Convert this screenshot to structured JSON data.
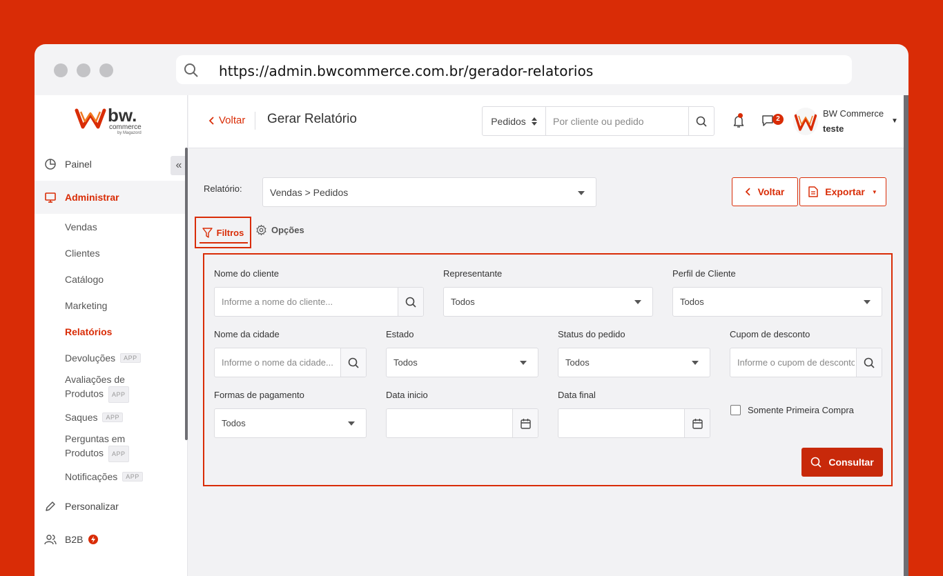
{
  "browser": {
    "url": "https://admin.bwcommerce.com.br/gerador-relatorios"
  },
  "brand": {
    "logo_text": "bw.",
    "logo_sub": "commerce",
    "logo_by": "by Magazord",
    "accent": "#d92c06"
  },
  "sidebar": {
    "collapse_glyph": "«",
    "items": [
      {
        "label": "Painel",
        "icon": "pie-chart-icon"
      },
      {
        "label": "Administrar",
        "icon": "monitor-icon",
        "active": true
      },
      {
        "label": "Personalizar",
        "icon": "pencil-icon"
      },
      {
        "label": "B2B",
        "icon": "users-icon"
      }
    ],
    "sub_items": [
      {
        "label": "Vendas"
      },
      {
        "label": "Clientes"
      },
      {
        "label": "Catálogo"
      },
      {
        "label": "Marketing"
      },
      {
        "label": "Relatórios",
        "active": true
      },
      {
        "label": "Devoluções",
        "tag": "APP"
      },
      {
        "label_1": "Avaliações de",
        "label_2": "Produtos",
        "tag": "APP"
      },
      {
        "label": "Saques",
        "tag": "APP"
      },
      {
        "label_1": "Perguntas em",
        "label_2": "Produtos",
        "tag": "APP"
      },
      {
        "label": "Notificações",
        "tag": "APP"
      }
    ]
  },
  "topbar": {
    "back_label": "Voltar",
    "title": "Gerar Relatório",
    "search_scope": "Pedidos",
    "search_placeholder": "Por cliente ou pedido",
    "chat_count": "2",
    "user_name": "BW Commerce",
    "user_sub": "teste"
  },
  "report": {
    "label": "Relatório:",
    "value": "Vendas > Pedidos",
    "back_button": "Voltar",
    "export_button": "Exportar"
  },
  "tabs": {
    "filters": "Filtros",
    "options": "Opções"
  },
  "filters": {
    "client_name": {
      "label": "Nome do cliente",
      "placeholder": "Informe a nome do cliente..."
    },
    "representative": {
      "label": "Representante",
      "value": "Todos"
    },
    "client_profile": {
      "label": "Perfil de Cliente",
      "value": "Todos"
    },
    "city": {
      "label": "Nome da cidade",
      "placeholder": "Informe o nome da cidade..."
    },
    "state": {
      "label": "Estado",
      "value": "Todos"
    },
    "order_status": {
      "label": "Status do pedido",
      "value": "Todos"
    },
    "coupon": {
      "label": "Cupom de desconto",
      "placeholder": "Informe o cupom de desconto"
    },
    "payment": {
      "label": "Formas de pagamento",
      "value": "Todos"
    },
    "date_start": {
      "label": "Data inicio"
    },
    "date_end": {
      "label": "Data final"
    },
    "first_purchase": {
      "label": "Somente Primeira Compra"
    },
    "submit": "Consultar"
  }
}
